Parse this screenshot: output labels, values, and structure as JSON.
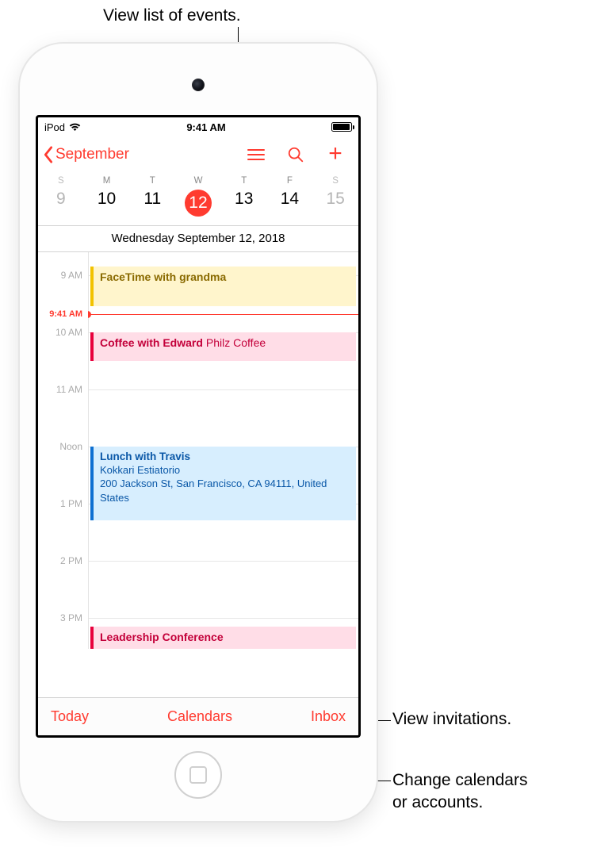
{
  "callouts": {
    "listView": "View list of events.",
    "inbox": "View invitations.",
    "calendars": "Change calendars\nor accounts."
  },
  "statusBar": {
    "carrier": "iPod",
    "time": "9:41 AM"
  },
  "nav": {
    "backLabel": "September"
  },
  "week": {
    "dayLetters": [
      "S",
      "M",
      "T",
      "W",
      "T",
      "F",
      "S"
    ],
    "dates": [
      "9",
      "10",
      "11",
      "12",
      "13",
      "14",
      "15"
    ],
    "selectedIndex": 3,
    "subtitle": "Wednesday  September 12, 2018"
  },
  "timeline": {
    "hourHeight": 72,
    "startOffsetHours": 8.6,
    "nowLabel": "9:41 AM",
    "nowHour": 9.683,
    "hours": [
      {
        "label": "9 AM",
        "h": 9
      },
      {
        "label": "10 AM",
        "h": 10
      },
      {
        "label": "11 AM",
        "h": 11
      },
      {
        "label": "Noon",
        "h": 12
      },
      {
        "label": "1 PM",
        "h": 13
      },
      {
        "label": "2 PM",
        "h": 14
      },
      {
        "label": "3 PM",
        "h": 15
      }
    ],
    "events": [
      {
        "title": "FaceTime with grandma",
        "locationInline": "",
        "locationBlock": "",
        "start": 8.85,
        "end": 9.55,
        "colorClass": "ev-yellow",
        "name": "event-facetime-grandma"
      },
      {
        "title": "Coffee with Edward",
        "locationInline": "Philz Coffee",
        "locationBlock": "",
        "start": 10.0,
        "end": 10.5,
        "colorClass": "ev-pink",
        "name": "event-coffee-edward"
      },
      {
        "title": "Lunch with Travis",
        "locationInline": "",
        "locationBlock": "Kokkari Estiatorio\n200 Jackson St, San Francisco, CA  94111, United States",
        "start": 12.0,
        "end": 13.3,
        "colorClass": "ev-blue",
        "name": "event-lunch-travis"
      },
      {
        "title": "Leadership Conference",
        "locationInline": "",
        "locationBlock": "",
        "start": 15.15,
        "end": 16.5,
        "colorClass": "ev-pink",
        "name": "event-leadership-conference"
      }
    ]
  },
  "toolbar": {
    "today": "Today",
    "calendars": "Calendars",
    "inbox": "Inbox"
  }
}
